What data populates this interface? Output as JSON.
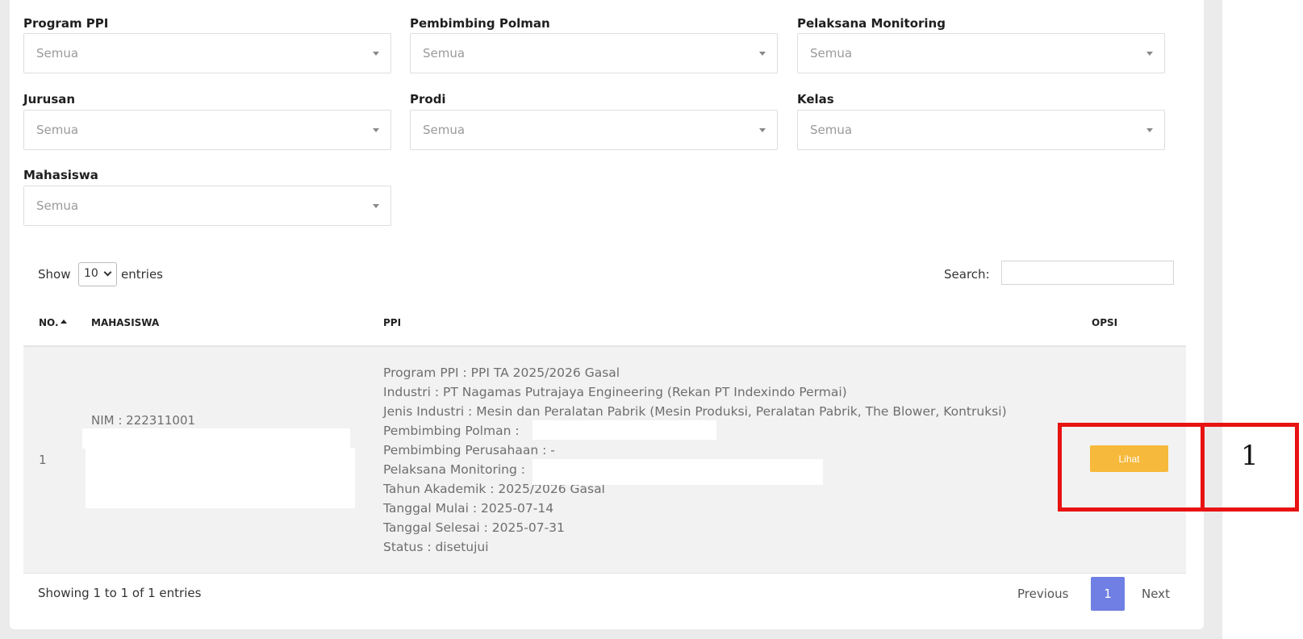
{
  "filters": [
    {
      "label": "Program PPI",
      "value": "Semua"
    },
    {
      "label": "Pembimbing Polman",
      "value": "Semua"
    },
    {
      "label": "Pelaksana Monitoring",
      "value": "Semua"
    },
    {
      "label": "Jurusan",
      "value": "Semua"
    },
    {
      "label": "Prodi",
      "value": "Semua"
    },
    {
      "label": "Kelas",
      "value": "Semua"
    },
    {
      "label": "Mahasiswa",
      "value": "Semua"
    }
  ],
  "table_controls": {
    "show_label": "Show",
    "entries_value": "10",
    "entries_label": "entries",
    "search_label": "Search:",
    "search_value": ""
  },
  "table": {
    "headers": {
      "no": "NO.",
      "mahasiswa": "MAHASISWA",
      "ppi": "PPI",
      "opsi": "OPSI"
    },
    "rows": [
      {
        "no": "1",
        "mahasiswa": "NIM : 222311001",
        "ppi": [
          "Program PPI : PPI TA 2025/2026 Gasal",
          "Industri : PT Nagamas Putrajaya Engineering (Rekan PT Indexindo Permai)",
          "Jenis Industri : Mesin dan Peralatan Pabrik (Mesin Produksi, Peralatan Pabrik, The Blower, Kontruksi)",
          "Pembimbing Polman :",
          "Pembimbing Perusahaan : -",
          "Pelaksana Monitoring :",
          "Tahun Akademik : 2025/2026 Gasal",
          "Tanggal Mulai : 2025-07-14",
          "Tanggal Selesai : 2025-07-31",
          "Status : disetujui"
        ],
        "action_label": "Lihat"
      }
    ]
  },
  "footer": {
    "info": "Showing 1 to 1 of 1 entries",
    "previous": "Previous",
    "current_page": "1",
    "next": "Next"
  },
  "annotation": {
    "number": "1",
    "color": "#e81212"
  },
  "colors": {
    "accent_button": "#f6b93b",
    "pagination_active": "#6f7fe3"
  }
}
